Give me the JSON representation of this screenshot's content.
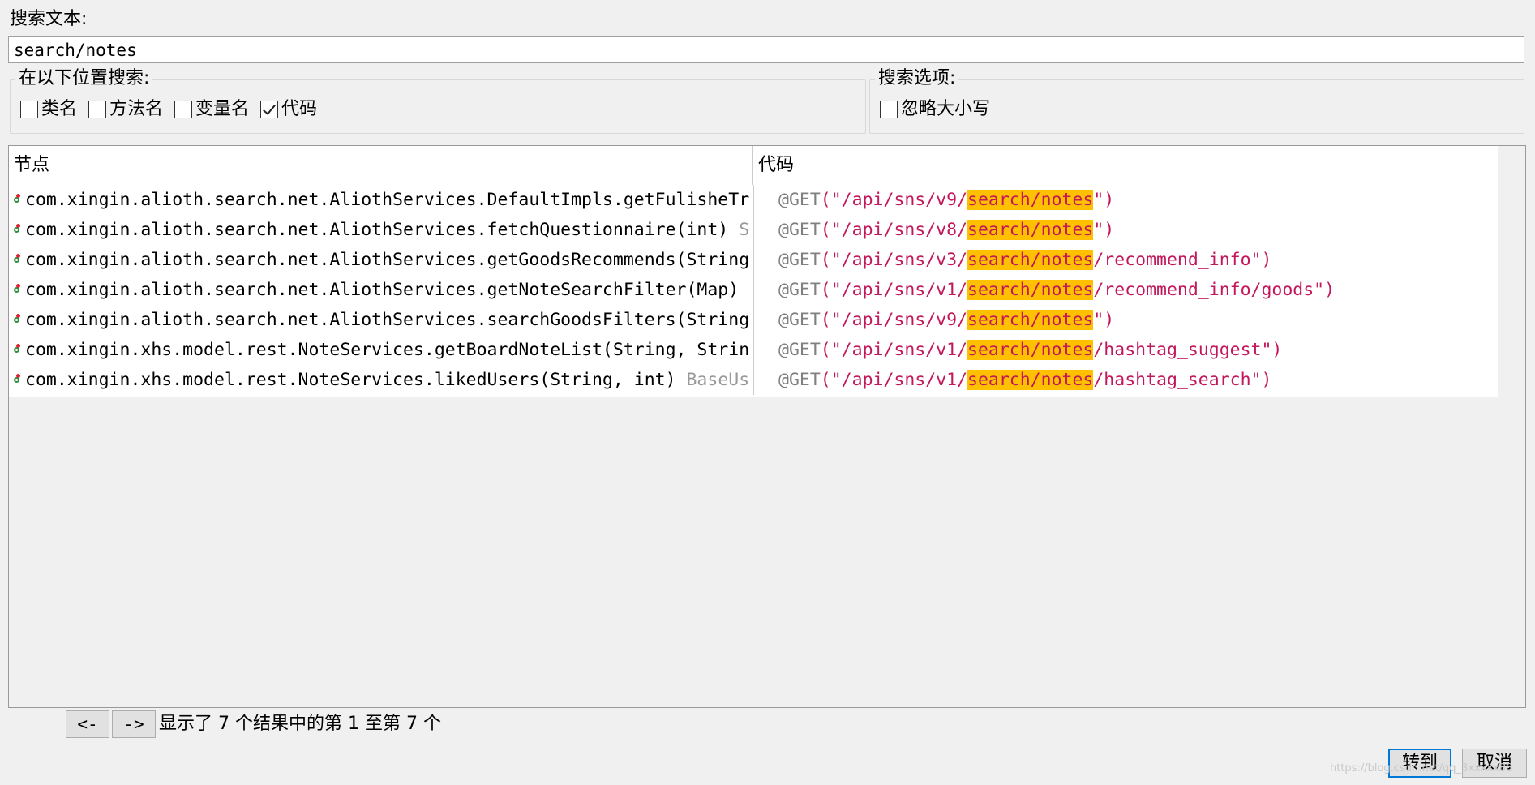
{
  "search": {
    "label": "搜索文本:",
    "value": "search/notes"
  },
  "location_group": {
    "title": "在以下位置搜索:",
    "options": [
      {
        "label": "类名",
        "checked": false
      },
      {
        "label": "方法名",
        "checked": false
      },
      {
        "label": "变量名",
        "checked": false
      },
      {
        "label": "代码",
        "checked": true
      }
    ]
  },
  "options_group": {
    "title": "搜索选项:",
    "options": [
      {
        "label": "忽略大小写",
        "checked": false
      }
    ]
  },
  "table": {
    "headers": {
      "node": "节点",
      "code": "代码"
    },
    "rows": [
      {
        "node": "com.xingin.alioth.search.net.AliothServices.DefaultImpls.getFulisheTr",
        "ret": "",
        "ann": "@GET",
        "prefix": "\"/api/sns/v9/",
        "match": "search/notes",
        "suffix": "\")"
      },
      {
        "node": "com.xingin.alioth.search.net.AliothServices.fetchQuestionnaire(int) ",
        "ret": "S",
        "ann": "@GET",
        "prefix": "\"/api/sns/v8/",
        "match": "search/notes",
        "suffix": "\")"
      },
      {
        "node": "com.xingin.alioth.search.net.AliothServices.getGoodsRecommends(String",
        "ret": "",
        "ann": "@GET",
        "prefix": "\"/api/sns/v3/",
        "match": "search/notes",
        "suffix": "/recommend_info\")"
      },
      {
        "node": "com.xingin.alioth.search.net.AliothServices.getNoteSearchFilter(Map)",
        "ret": "",
        "ann": "@GET",
        "prefix": "\"/api/sns/v1/",
        "match": "search/notes",
        "suffix": "/recommend_info/goods\")"
      },
      {
        "node": "com.xingin.alioth.search.net.AliothServices.searchGoodsFilters(String",
        "ret": "",
        "ann": "@GET",
        "prefix": "\"/api/sns/v9/",
        "match": "search/notes",
        "suffix": "\")"
      },
      {
        "node": "com.xingin.xhs.model.rest.NoteServices.getBoardNoteList(String, Strin",
        "ret": "",
        "ann": "@GET",
        "prefix": "\"/api/sns/v1/",
        "match": "search/notes",
        "suffix": "/hashtag_suggest\")"
      },
      {
        "node": "com.xingin.xhs.model.rest.NoteServices.likedUsers(String, int) ",
        "ret": "BaseUs",
        "ann": "@GET",
        "prefix": "\"/api/sns/v1/",
        "match": "search/notes",
        "suffix": "/hashtag_search\")"
      }
    ]
  },
  "nav": {
    "prev": "<-",
    "next": "->"
  },
  "status": "显示了 7 个结果中的第 1 至第 7 个",
  "buttons": {
    "goto": "转到",
    "cancel": "取消"
  },
  "watermark": "https://blog.csdn.net/qq_3xxxxx88"
}
